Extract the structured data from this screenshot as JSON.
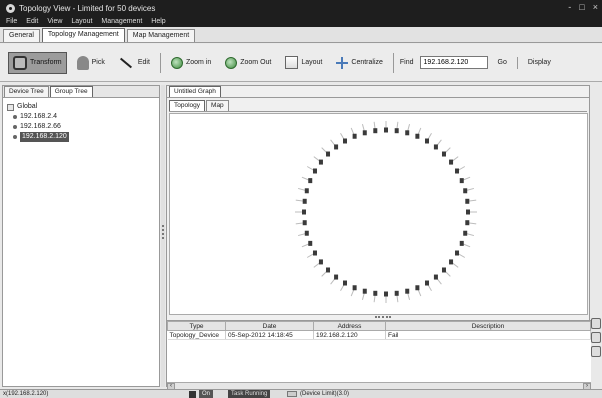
{
  "window": {
    "title": "Topology View - Limited for 50 devices",
    "controls": [
      "-",
      "□",
      "×"
    ]
  },
  "menu": [
    "File",
    "Edit",
    "View",
    "Layout",
    "Management",
    "Help"
  ],
  "main_tabs": [
    {
      "label": "General",
      "active": false
    },
    {
      "label": "Topology Management",
      "active": true
    },
    {
      "label": "Map Management",
      "active": false
    }
  ],
  "toolbar": {
    "transform": "Transform",
    "pick": "Pick",
    "edit": "Edit",
    "zoom_in": "Zoom in",
    "zoom_out": "Zoom Out",
    "layout": "Layout",
    "centralize": "Centralize",
    "find_label": "Find",
    "find_value": "192.168.2.120",
    "go": "Go",
    "display": "Display"
  },
  "left_tabs": [
    {
      "label": "Device Tree",
      "active": false
    },
    {
      "label": "Group Tree",
      "active": true
    }
  ],
  "tree": {
    "root": "Global",
    "items": [
      {
        "label": "192.168.2.4",
        "selected": false
      },
      {
        "label": "192.168.2.66",
        "selected": false
      },
      {
        "label": "192.168.2.120",
        "selected": true
      }
    ]
  },
  "graph_tab": "Untitled Graph",
  "sub_tabs": [
    {
      "label": "Topology",
      "active": true
    },
    {
      "label": "Map",
      "active": false
    }
  ],
  "events_table": {
    "headers": [
      "Type",
      "Date",
      "Address",
      "Description"
    ],
    "rows": [
      [
        "Topology_Device",
        "05-Sep-2012 14:18:45",
        "192.168.2.120",
        "Fail"
      ]
    ]
  },
  "status": {
    "coord": "x(192.168.2.120)",
    "on": "On",
    "task": "Task Running",
    "device_limit": "(Device Limit)(3.0)"
  },
  "colors": {
    "titlebar": "#1e1e1e",
    "node": "#3a3a3a",
    "active_button": "#9c9c9c"
  },
  "graph": {
    "node_count": 48
  }
}
